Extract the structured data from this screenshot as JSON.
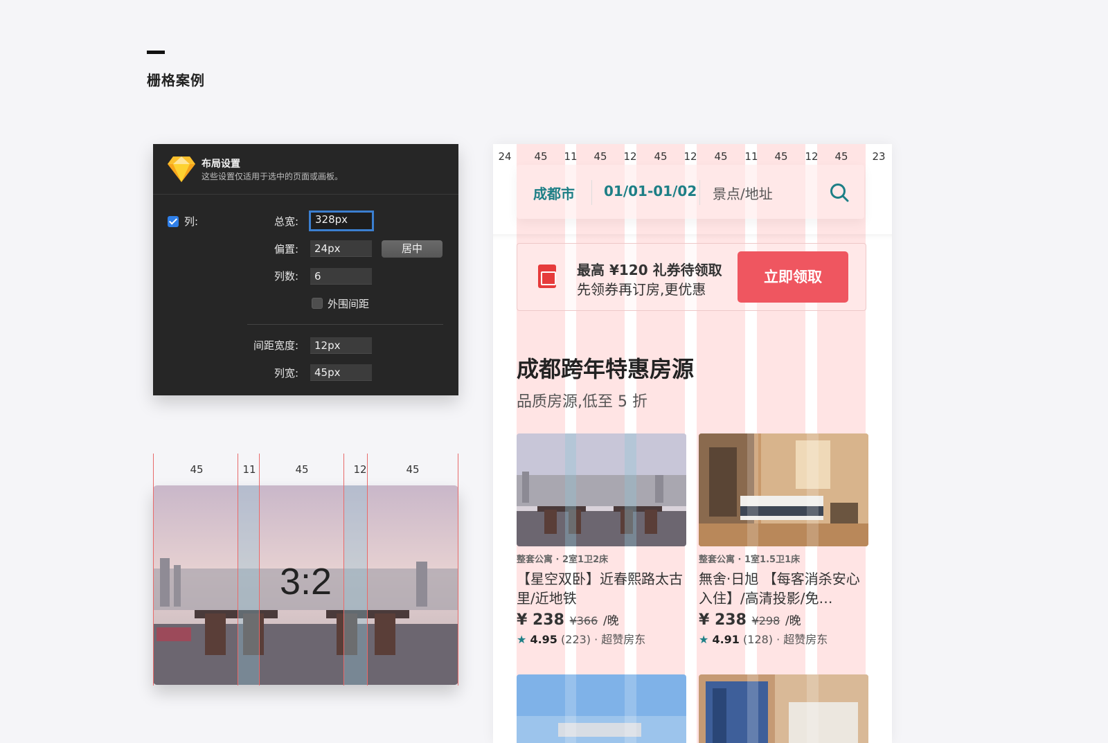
{
  "section": {
    "title": "栅格案例"
  },
  "panel": {
    "title": "布局设置",
    "subtitle": "这些设置仅适用于选中的页面或画板。",
    "columns_label": "列:",
    "total_width_label": "总宽:",
    "total_width_value": "328px",
    "offset_label": "偏置:",
    "offset_value": "24px",
    "center_button": "居中",
    "count_label": "列数:",
    "count_value": "6",
    "outer_gap_label": "外围间距",
    "gutter_label": "间距宽度:",
    "gutter_value": "12px",
    "col_width_label": "列宽:",
    "col_width_value": "45px",
    "columns_checked": true,
    "outer_gap_checked": false
  },
  "ratio": {
    "text": "3:2",
    "col_labels": [
      "45",
      "11",
      "45",
      "12",
      "45"
    ]
  },
  "phone": {
    "grid_labels": [
      "24",
      "45",
      "11",
      "45",
      "12",
      "45",
      "12",
      "45",
      "11",
      "45",
      "12",
      "45",
      "23"
    ],
    "search": {
      "city": "成都市",
      "dates": "01/01-01/02",
      "placeholder": "景点/地址"
    },
    "coupon": {
      "title": "最高 ¥120 礼券待领取",
      "subtitle": "先领券再订房,更优惠",
      "button": "立即领取"
    },
    "heading": "成都跨年特惠房源",
    "subheading": "品质房源,低至 5 折",
    "cards": [
      {
        "type": "整套公寓 · 2室1卫2床",
        "title": "【星空双卧】近春熙路太古里/近地铁",
        "price": "¥ 238",
        "old_price": "¥366",
        "unit": "/晚",
        "rating": "4.95",
        "reviews": "(223) · 超赞房东"
      },
      {
        "type": "整套公寓 · 1室1.5卫1床",
        "title": "無舍·日旭 【每客消杀安心入住】/高清投影/免…",
        "price": "¥ 238",
        "old_price": "¥298",
        "unit": "/晚",
        "rating": "4.91",
        "reviews": "(128) · 超赞房东"
      }
    ]
  },
  "colors": {
    "teal": "#1d7f86",
    "coupon_red": "#ef5660",
    "grid_pink": "#ffd6d6",
    "panel_bg": "#262626",
    "focus_blue": "#3b7fd0"
  }
}
